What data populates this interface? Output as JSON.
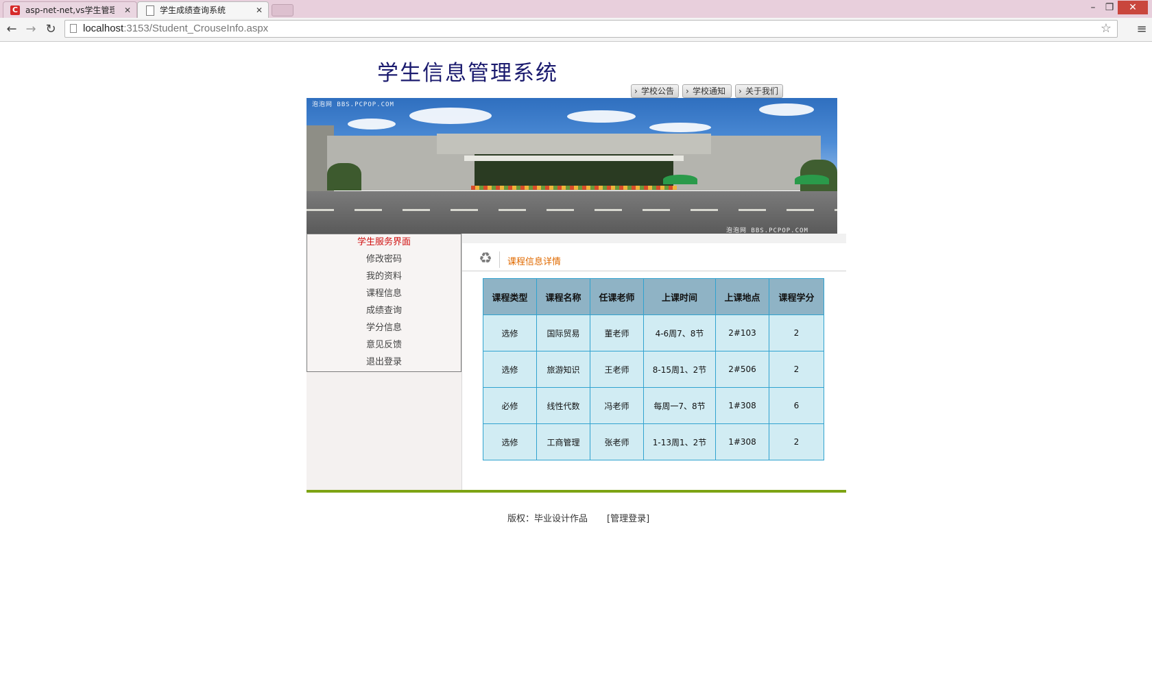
{
  "browser": {
    "tabs": [
      {
        "title": "asp-net-net,vs学生管理系",
        "active": false
      },
      {
        "title": "学生成绩查询系统",
        "active": true
      }
    ],
    "url_host": "localhost",
    "url_path": ":3153/Student_CrouseInfo.aspx"
  },
  "site": {
    "title": "学生信息管理系统",
    "top_nav": [
      "学校公告",
      "学校通知",
      "关于我们"
    ],
    "banner_watermark": "泡泡网 BBS.PCPOP.COM"
  },
  "sidebar": {
    "heading": "学生服务界面",
    "items": [
      "修改密码",
      "我的资料",
      "课程信息",
      "成绩查询",
      "学分信息",
      "意见反馈",
      "退出登录"
    ]
  },
  "main": {
    "section_title": "课程信息详情",
    "table": {
      "headers": [
        "课程类型",
        "课程名称",
        "任课老师",
        "上课时间",
        "上课地点",
        "课程学分"
      ],
      "rows": [
        [
          "选修",
          "国际贸易",
          "董老师",
          "4-6周7、8节",
          "2#103",
          "2"
        ],
        [
          "选修",
          "旅游知识",
          "王老师",
          "8-15周1、2节",
          "2#506",
          "2"
        ],
        [
          "必修",
          "线性代数",
          "冯老师",
          "每周一7、8节",
          "1#308",
          "6"
        ],
        [
          "选修",
          "工商管理",
          "张老师",
          "1-13周1、2节",
          "1#308",
          "2"
        ]
      ]
    }
  },
  "footer": {
    "copyright": "版权：毕业设计作品",
    "admin_login": "[管理登录]"
  },
  "colors": {
    "title": "#1a1a6e",
    "menu_heading": "#d01010",
    "section_title": "#e06a00",
    "table_header": "#8fb3c5",
    "table_cell": "#d1ecf3",
    "table_border": "#2fa2cf",
    "footer_line": "#7da313"
  },
  "icons": [
    "tab-favicon-icon",
    "page-icon",
    "back-arrow-icon",
    "forward-arrow-icon",
    "reload-icon",
    "star-icon",
    "menu-icon",
    "recycle-icon"
  ]
}
